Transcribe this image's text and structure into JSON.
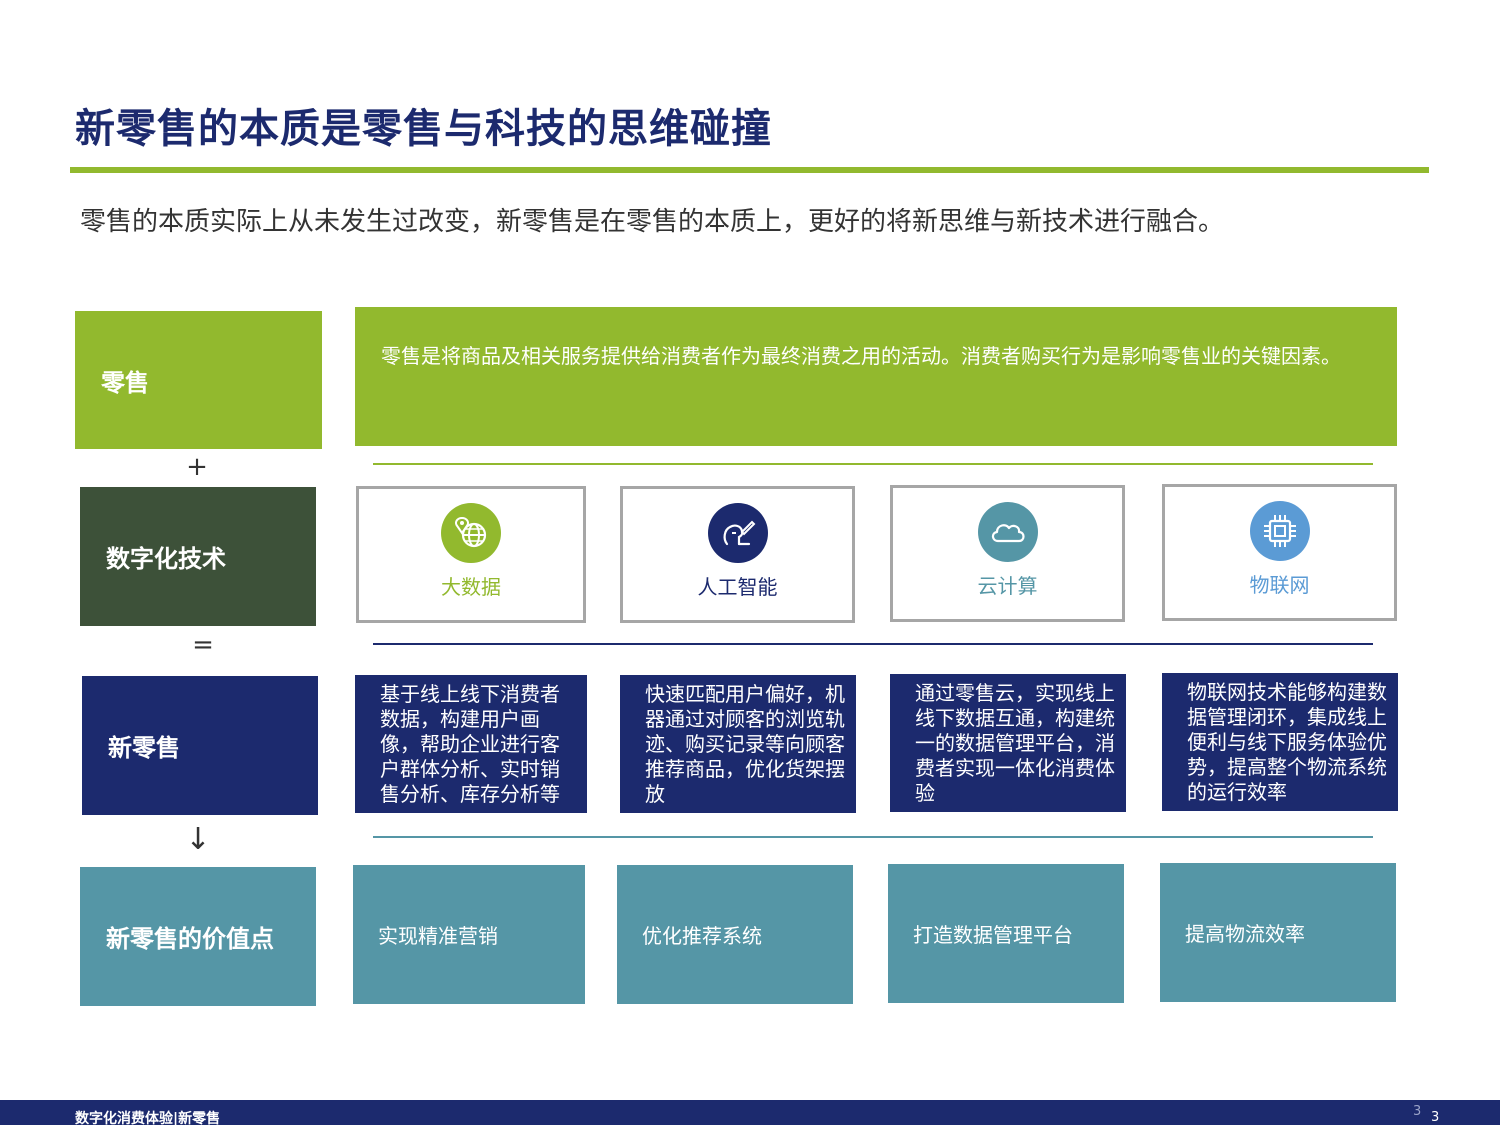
{
  "title": "新零售的本质是零售与科技的思维碰撞",
  "subtitle": "零售的本质实际上从未发生过改变，新零售是在零售的本质上，更好的将新思维与新技术进行融合。",
  "rows": {
    "retail": {
      "label": "零售",
      "description": "零售是将商品及相关服务提供给消费者作为最终消费之用的活动。消费者购买行为是影响零售业的关键因素。"
    },
    "digital_tech": {
      "label": "数字化技术"
    },
    "new_retail": {
      "label": "新零售"
    },
    "value_points": {
      "label": "新零售的价值点"
    }
  },
  "operators": {
    "plus": "+",
    "equals": "=",
    "arrow": "↓"
  },
  "technologies": [
    {
      "label": "大数据",
      "icon": "globe-pin-icon",
      "color": "#92b92e"
    },
    {
      "label": "人工智能",
      "icon": "ai-head-icon",
      "color": "#1c2a6e"
    },
    {
      "label": "云计算",
      "icon": "cloud-icon",
      "color": "#5596a6"
    },
    {
      "label": "物联网",
      "icon": "chip-icon",
      "color": "#5b9bd5"
    }
  ],
  "descriptions": [
    {
      "text": "基于线上线下消费者数据，构建用户画像，帮助企业进行客户群体分析、实时销售分析、库存分析等"
    },
    {
      "text": "快速匹配用户偏好，机器通过对顾客的浏览轨迹、购买记录等向顾客推荐商品，优化货架摆放"
    },
    {
      "text": "通过零售云，实现线上线下数据互通，构建统一的数据管理平台，消费者实现一体化消费体验"
    },
    {
      "text": "物联网技术能够构建数据管理闭环，集成线上便利与线下服务体验优势，提高整个物流系统的运行效率"
    }
  ],
  "values": [
    {
      "text": "实现精准营销"
    },
    {
      "text": "优化推荐系统"
    },
    {
      "text": "打造数据管理平台"
    },
    {
      "text": "提高物流效率"
    }
  ],
  "footer": {
    "text": "数字化消费体验|新零售",
    "page_a": "3",
    "page_b": "3"
  },
  "colors": {
    "navy": "#1c2a6e",
    "green": "#92b92e",
    "dark_green": "#3d5139",
    "teal": "#5596a6",
    "blue": "#5b9bd5"
  }
}
